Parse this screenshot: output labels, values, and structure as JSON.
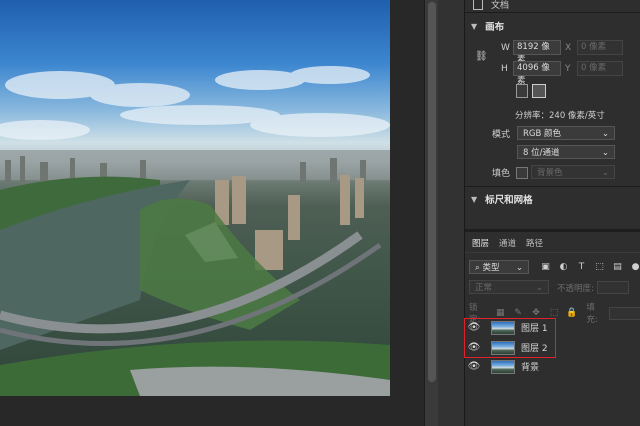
{
  "top_item": {
    "label": "文档"
  },
  "canvas_section": {
    "title": "画布",
    "w_label": "W",
    "w_value": "8192 像素",
    "h_label": "H",
    "h_value": "4096 像素",
    "x_label": "X",
    "x_value": "0 像素",
    "y_label": "Y",
    "y_value": "0 像素",
    "resolution": "分辨率：240 像素/英寸",
    "mode_label": "模式",
    "mode_value": "RGB 颜色",
    "depth_value": "8 位/通道",
    "fill_label": "填色",
    "fill_value": "背景色"
  },
  "rulers_section": {
    "title": "标尺和网格"
  },
  "layers_panel": {
    "tabs": [
      "图层",
      "通道",
      "路径"
    ],
    "filter_label": "类型",
    "blend_mode": "正常",
    "opacity_label": "不透明度:",
    "lock_label": "锁定:",
    "fill_label": "填充:",
    "layers": [
      {
        "name": "图层 1",
        "visible": true,
        "highlighted": true
      },
      {
        "name": "图层 2",
        "visible": true,
        "highlighted": true
      },
      {
        "name": "背景",
        "visible": true,
        "highlighted": false
      }
    ]
  },
  "colors": {
    "highlight": "#e0202a",
    "panel_bg": "#2e2e2e",
    "canvas_bg": "#282828"
  }
}
